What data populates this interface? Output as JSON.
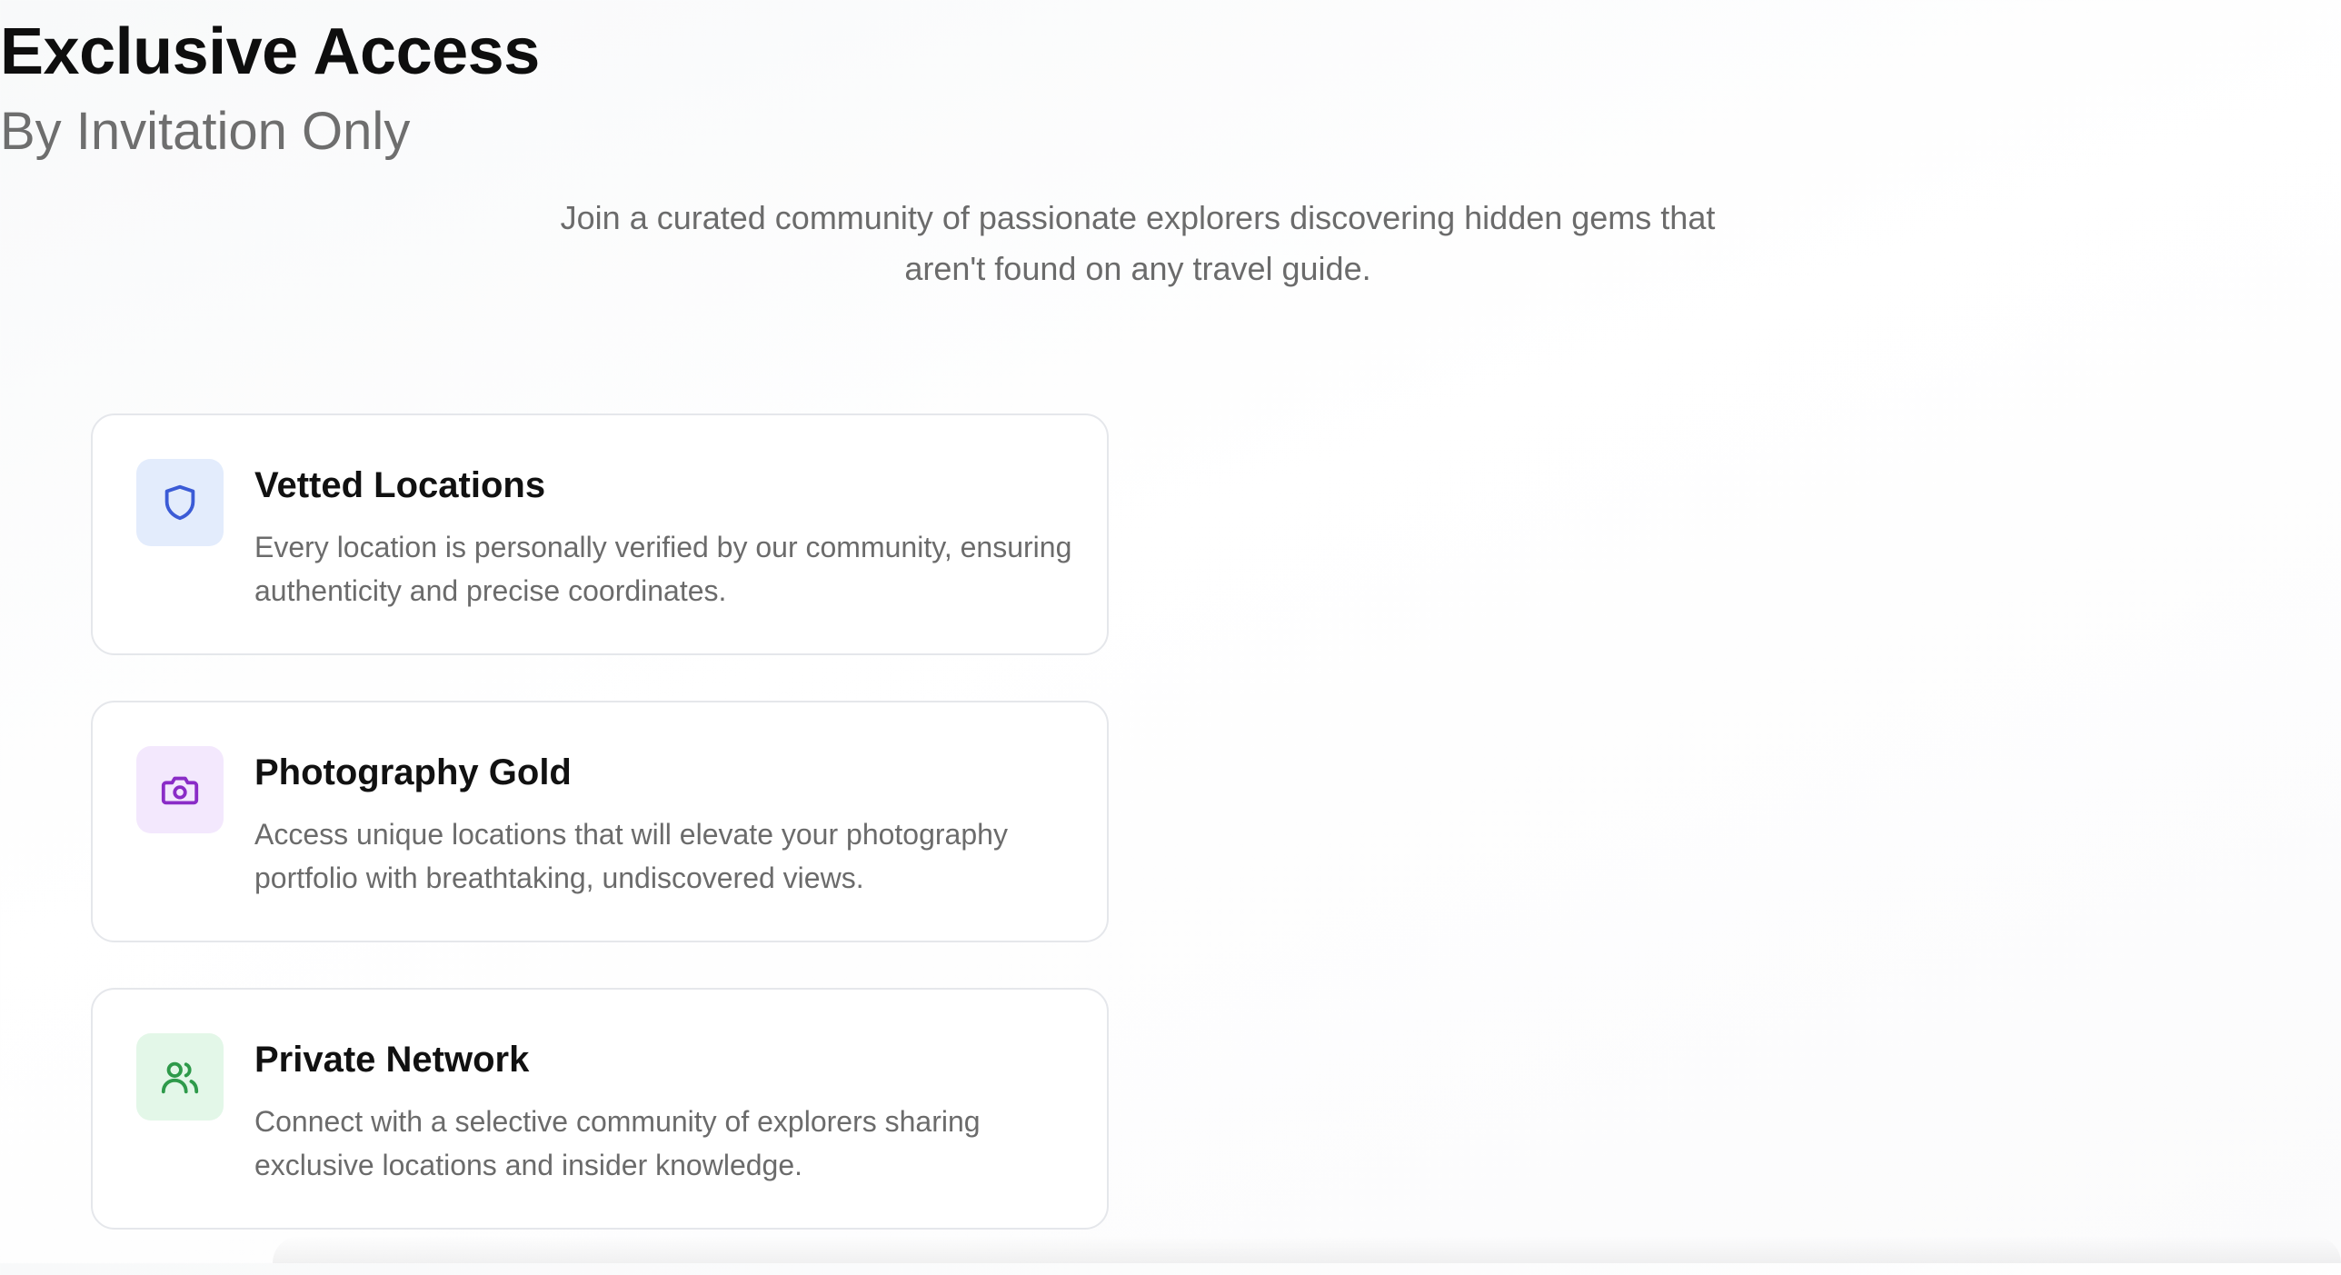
{
  "hero": {
    "title": "Exclusive Access",
    "subtitle": "By Invitation Only",
    "intro": "Join a curated community of passionate explorers discovering hidden gems that aren't found on any travel guide."
  },
  "features": [
    {
      "title": "Vetted Locations",
      "description": "Every location is personally verified by our community, ensuring authenticity and precise coordinates.",
      "icon": "shield-icon",
      "icon_color": "#3b5bd6",
      "icon_bg": "#e3ecfc"
    },
    {
      "title": "Photography Gold",
      "description": "Access unique locations that will elevate your photography portfolio with breathtaking, undiscovered views.",
      "icon": "camera-icon",
      "icon_color": "#8a2cc7",
      "icon_bg": "#f3e8fd"
    },
    {
      "title": "Private Network",
      "description": "Connect with a selective community of explorers sharing exclusive locations and insider knowledge.",
      "icon": "users-icon",
      "icon_color": "#2e9a4a",
      "icon_bg": "#e3f7e8"
    }
  ]
}
